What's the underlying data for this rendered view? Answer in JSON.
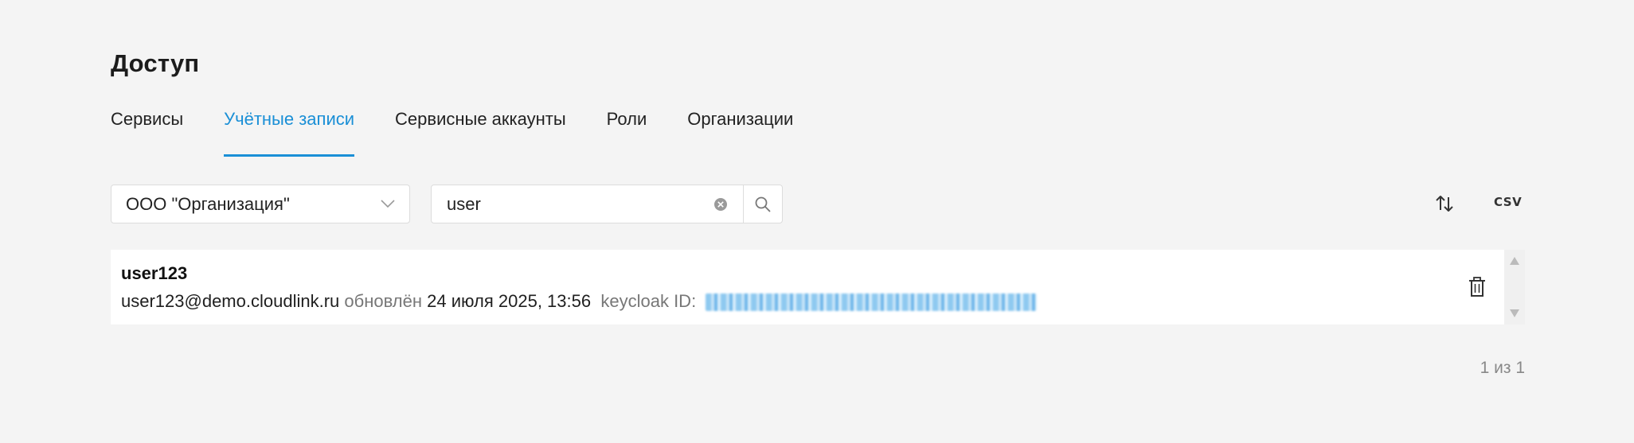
{
  "page": {
    "title": "Доступ"
  },
  "tabs": [
    {
      "label": "Сервисы",
      "active": false
    },
    {
      "label": "Учётные записи",
      "active": true
    },
    {
      "label": "Сервисные аккаунты",
      "active": false
    },
    {
      "label": "Роли",
      "active": false
    },
    {
      "label": "Организации",
      "active": false
    }
  ],
  "filters": {
    "organization": "ООО \"Организация\"",
    "search_value": "user"
  },
  "toolbar": {
    "sort_icon": "sort-arrows-icon",
    "csv_label": "CSV"
  },
  "users": [
    {
      "name": "user123",
      "email": "user123@demo.cloudlink.ru",
      "updated_label": "обновлён",
      "updated_at": "24 июля 2025, 13:56",
      "keycloak_label": "keycloak ID:"
    }
  ],
  "pagination": {
    "text": "1 из 1"
  },
  "colors": {
    "accent": "#1a8fd6",
    "background": "#f4f4f4",
    "muted_text": "#777777"
  }
}
